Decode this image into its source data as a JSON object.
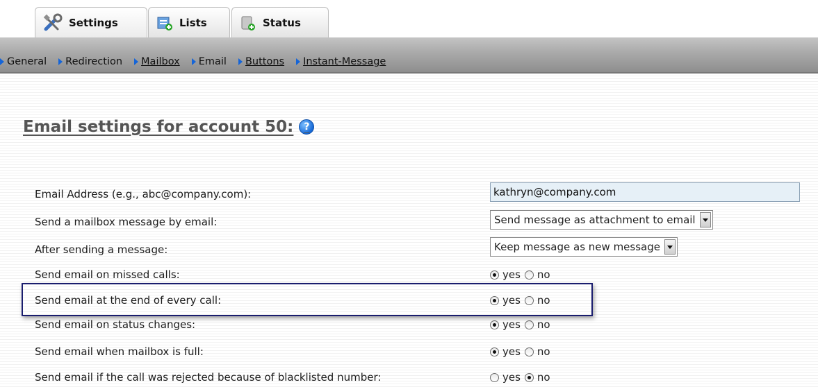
{
  "tabs": [
    {
      "label": "Settings",
      "icon": "settings-tools-icon",
      "active": true
    },
    {
      "label": "Lists",
      "icon": "lists-icon",
      "active": false
    },
    {
      "label": "Status",
      "icon": "status-icon",
      "active": false
    }
  ],
  "subnav": [
    {
      "label": "General",
      "link": false
    },
    {
      "label": "Redirection",
      "link": false
    },
    {
      "label": "Mailbox",
      "link": true
    },
    {
      "label": "Email",
      "link": false
    },
    {
      "label": "Buttons",
      "link": true
    },
    {
      "label": "Instant-Message",
      "link": true
    }
  ],
  "page": {
    "title": "Email settings for account 50:",
    "help_icon": "?"
  },
  "form": {
    "email": {
      "label": "Email Address (e.g., abc@company.com):",
      "value": "kathryn@company.com"
    },
    "send_mailbox": {
      "label": "Send a mailbox message by email:",
      "selected": "Send message as attachment to email"
    },
    "after_sending": {
      "label": "After sending a message:",
      "selected": "Keep message as new message"
    },
    "radios": [
      {
        "label": "Send email on missed calls:",
        "value": "yes"
      },
      {
        "label": "Send email at the end of every call:",
        "value": "yes"
      },
      {
        "label": "Send email on status changes:",
        "value": "yes"
      },
      {
        "label": "Send email when mailbox is full:",
        "value": "yes"
      },
      {
        "label": "Send email if the call was rejected because of blacklisted number:",
        "value": "no"
      }
    ],
    "yes_label": "yes",
    "no_label": "no"
  },
  "colors": {
    "highlight_border": "#1a1d6e",
    "nav_arrow": "#1565d8",
    "input_bg": "#e6f0f7"
  }
}
